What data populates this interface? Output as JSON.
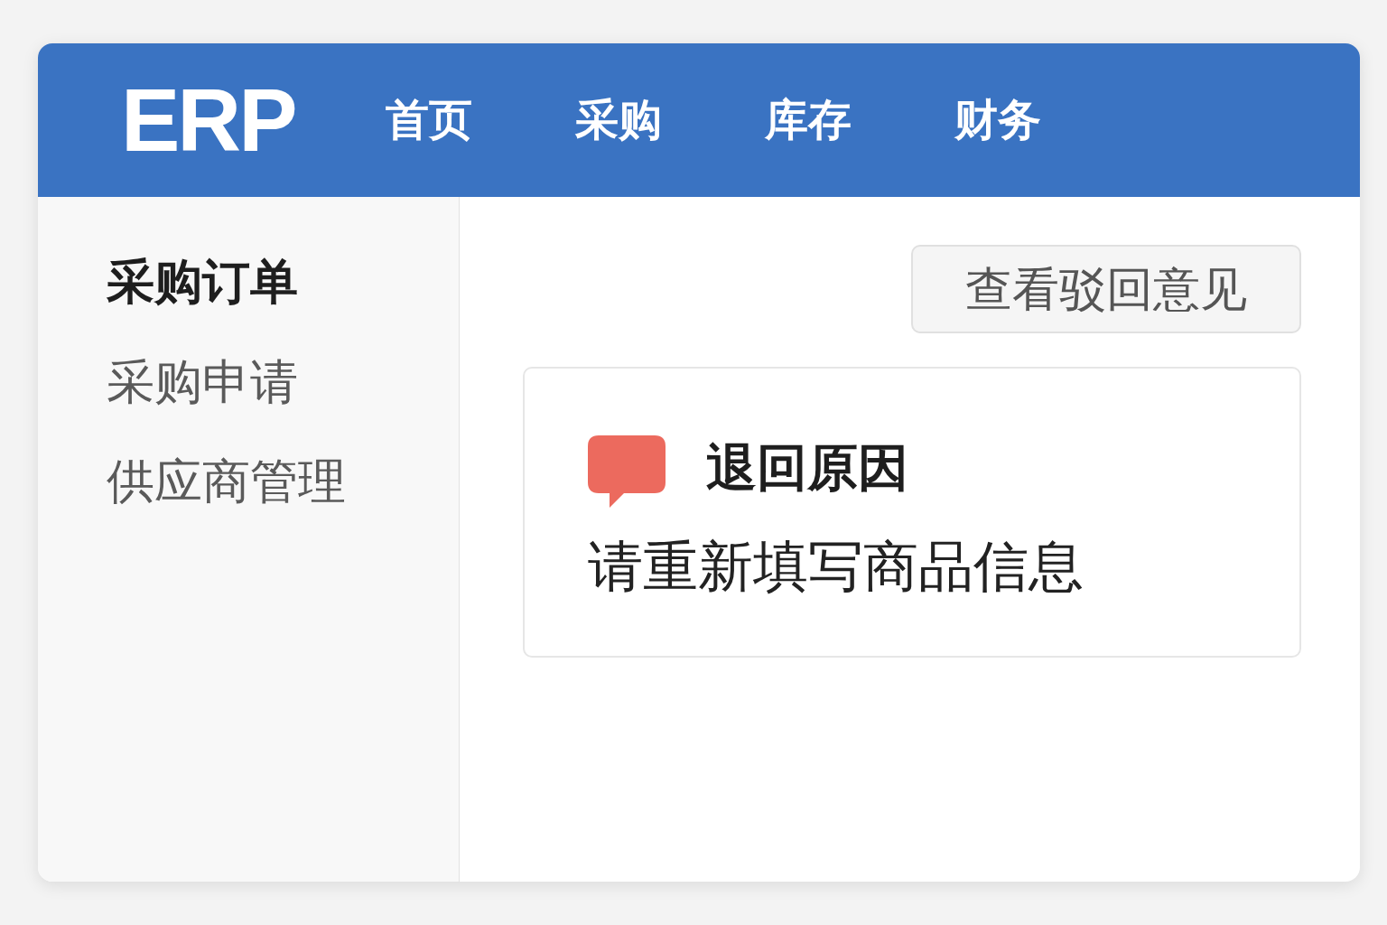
{
  "header": {
    "logo": "ERP",
    "nav": [
      "首页",
      "采购",
      "库存",
      "财务"
    ]
  },
  "sidebar": {
    "items": [
      {
        "label": "采购订单",
        "selected": true
      },
      {
        "label": "采购申请",
        "selected": false
      },
      {
        "label": "供应商管理",
        "selected": false
      }
    ]
  },
  "main": {
    "button": "查看驳回意见",
    "reason_card": {
      "title": "退回原因",
      "message": "请重新填写商品信息"
    }
  }
}
